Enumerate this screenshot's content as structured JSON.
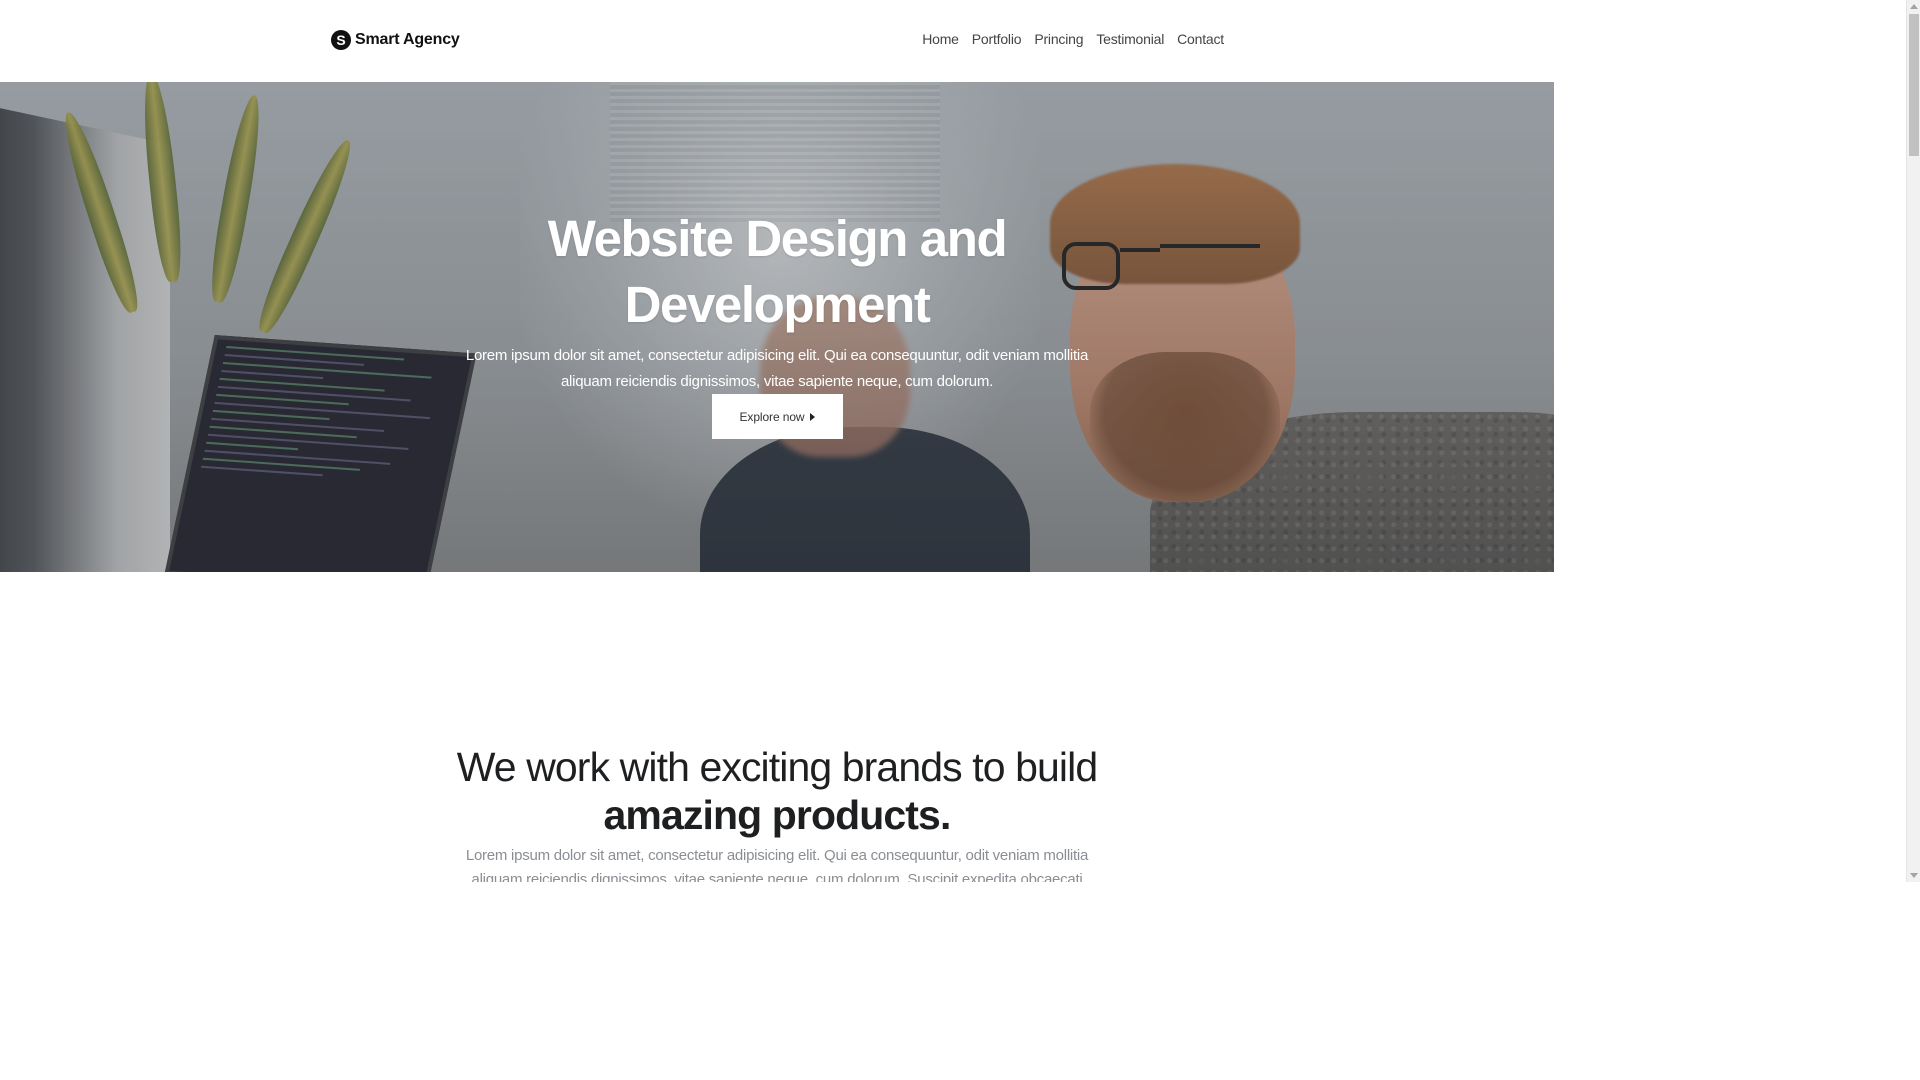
{
  "header": {
    "brand": {
      "logo_letter": "S",
      "name": "Smart Agency"
    },
    "nav": [
      {
        "label": "Home"
      },
      {
        "label": "Portfolio"
      },
      {
        "label": "Princing"
      },
      {
        "label": "Testimonial"
      },
      {
        "label": "Contact"
      }
    ]
  },
  "hero": {
    "title_line1": "Website Design and",
    "title_line2": "Development",
    "description": "Lorem ipsum dolor sit amet, consectetur adipisicing elit. Qui ea consequuntur, odit veniam mollitia aliquam reiciendis dignissimos, vitae sapiente neque, cum dolorum.",
    "cta_label": "Explore now",
    "cta_icon": "caret-right-icon"
  },
  "brands_section": {
    "title_line1": "We work with exciting brands to build",
    "title_line2": "amazing products.",
    "description": "Lorem ipsum dolor sit amet, consectetur adipisicing elit. Qui ea consequuntur, odit veniam mollitia aliquam reiciendis dignissimos, vitae sapiente neque, cum dolorum. Suscipit expedita obcaecati nesciunt error ut."
  },
  "colors": {
    "text_dark": "#1d1f21",
    "muted": "#8a8e93",
    "hero_text": "#ffffff",
    "cta_bg": "#ffffff"
  }
}
